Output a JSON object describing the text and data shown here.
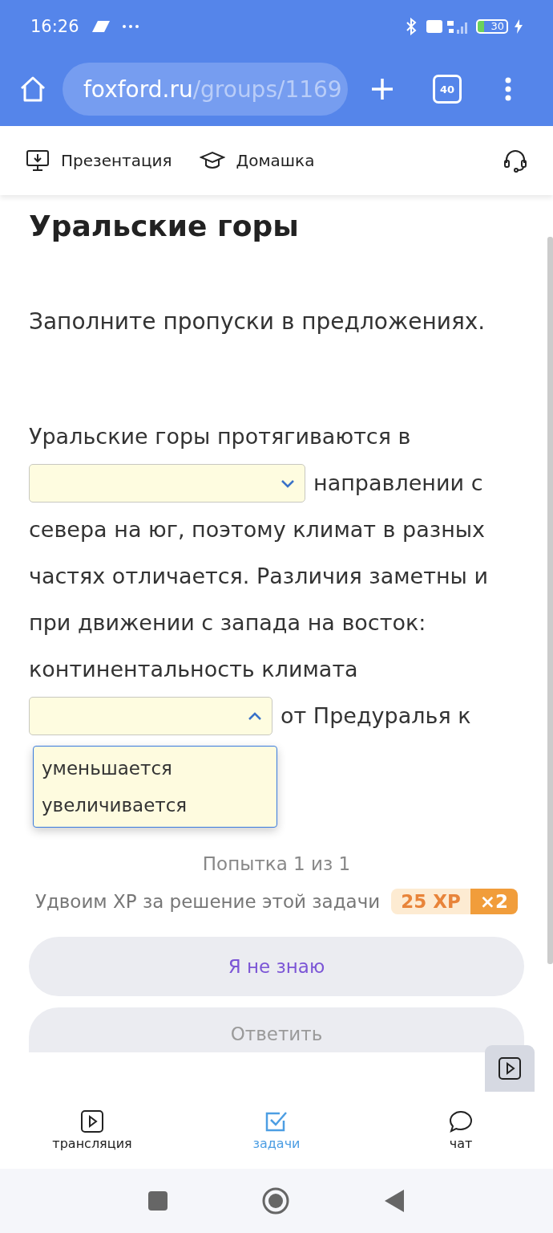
{
  "status_bar": {
    "time": "16:26",
    "battery": "30"
  },
  "browser": {
    "url_host": "foxford.ru",
    "url_path": "/groups/1169",
    "tab_count": "40"
  },
  "toolbar": {
    "items": [
      {
        "label": "Презентация",
        "kind": "presentation"
      },
      {
        "label": "Домашка",
        "kind": "homework"
      }
    ]
  },
  "task": {
    "title": "Уральские горы",
    "instruction": "Заполните пропуски в предложениях.",
    "segments": [
      {
        "kind": "text",
        "text": "Уральские горы протягиваются в"
      },
      {
        "kind": "select",
        "expanded": false
      },
      {
        "kind": "text",
        "text": "направлении с"
      },
      {
        "kind": "text",
        "text": "севера на юг, поэтому климат в разных частях отличается. Различия заметны и при движении с запада на восток: континентальность климата"
      },
      {
        "kind": "select",
        "expanded": true,
        "options": [
          "уменьшается",
          "увеличивается"
        ]
      },
      {
        "kind": "text",
        "text": "от Предуралья к"
      }
    ],
    "attempt": "Попытка 1 из 1",
    "bonus_text": "Удвоим XP за решение этой задачи",
    "xp": "25 XP",
    "multiplier": "×2",
    "buttons": [
      {
        "label": "Я не знаю",
        "kind": "secondary"
      },
      {
        "label": "Ответить",
        "kind": "submit"
      }
    ]
  },
  "bottom_nav": [
    {
      "label": "трансляция",
      "kind": "stream",
      "selected": false
    },
    {
      "label": "задачи",
      "kind": "tasks",
      "selected": true
    },
    {
      "label": "чат",
      "kind": "chat",
      "selected": false
    }
  ]
}
